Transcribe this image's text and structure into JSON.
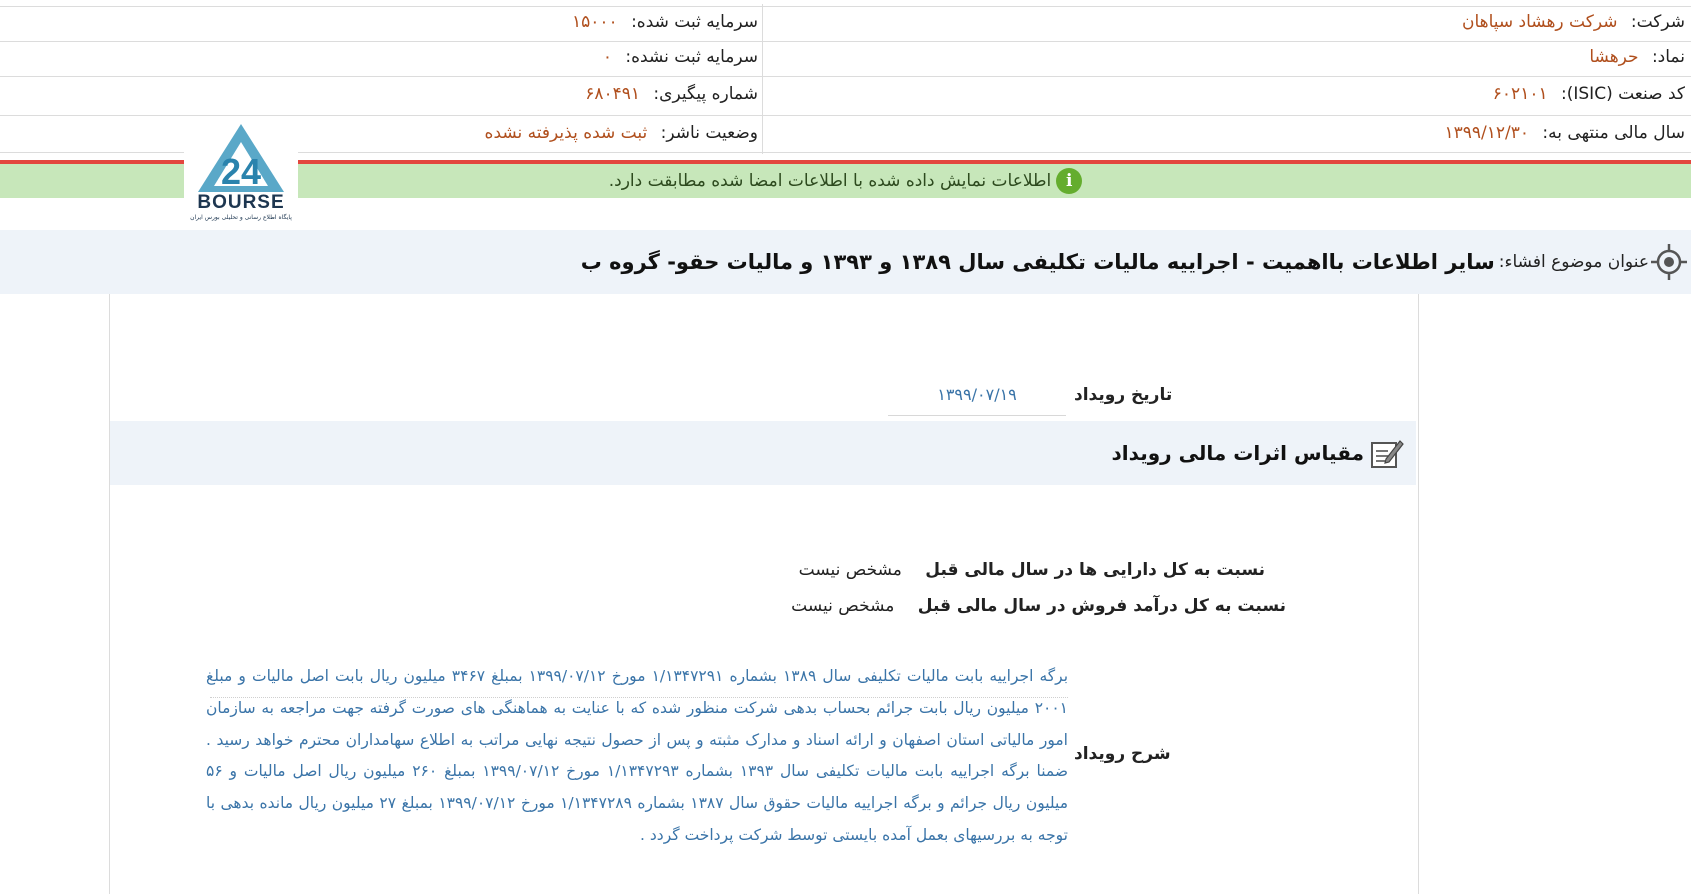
{
  "header": {
    "company_label": "شرکت:",
    "company_value": "شرکت رهشاد سپاهان",
    "symbol_label": "نماد:",
    "symbol_value": "حرهشا",
    "isic_label": "کد صنعت (ISIC):",
    "isic_value": "۶۰۲۱۰۱",
    "fiscal_label": "سال مالی منتهی به:",
    "fiscal_value": "۱۳۹۹/۱۲/۳۰",
    "registered_capital_label": "سرمایه ثبت شده:",
    "registered_capital_value": "۱۵۰۰۰",
    "unregistered_capital_label": "سرمایه ثبت نشده:",
    "unregistered_capital_value": "۰",
    "tracking_label": "شماره پیگیری:",
    "tracking_value": "۶۸۰۴۹۱",
    "publisher_status_label": "وضعیت ناشر:",
    "publisher_status_value": "ثبت شده پذیرفته نشده"
  },
  "colors": {
    "accent_value": "#b04f1d",
    "link_blue": "#3a74a8",
    "red_line": "#e3463e",
    "green_bar": "#c7e7ba",
    "info_green": "#64ad2e",
    "band_bg": "#eef3f9"
  },
  "notice": {
    "icon": "info-icon",
    "text": "اطلاعات نمایش داده شده با اطلاعات امضا شده مطابقت دارد."
  },
  "logo": {
    "word": "BOURSE",
    "subtitle": "پایگاه اطلاع رسانی و تحلیلی بورس ایران"
  },
  "subject": {
    "icon": "target-icon",
    "label": "عنوان موضوع افشاء:",
    "title": "سایر اطلاعات بااهمیت - اجراییه مالیات تکلیفی سال ۱۳۸۹ و ۱۳۹۳ و مالیات حقو- گروه ب"
  },
  "event": {
    "date_label": "تاریخ رویداد",
    "date_value": "۱۳۹۹/۰۷/۱۹"
  },
  "financial_impact": {
    "icon": "edit-icon",
    "title": "مقیاس اثرات مالی رویداد",
    "assets_label": "نسبت به کل دارایی ها در سال مالی قبل",
    "assets_value": "مشخص نیست",
    "revenue_label": "نسبت به کل درآمد فروش در سال مالی قبل",
    "revenue_value": "مشخص نیست"
  },
  "description": {
    "label": "شرح رویداد",
    "text": "برگه اجراییه بابت مالیات تکلیفی سال ۱۳۸۹ بشماره ۱/۱۳۴۷۲۹۱ مورخ ۱۳۹۹/۰۷/۱۲ بمبلغ ۳۴۶۷ میلیون ریال بابت اصل مالیات و مبلغ ۲۰۰۱ میلیون ریال بابت جرائم بحساب بدهی شرکت منظور شده که با عنایت به هماهنگی های صورت گرفته جهت مراجعه به سازمان امور مالیاتی استان اصفهان و ارائه اسناد و مدارک مثبته و پس از حصول نتیجه نهایی مراتب به اطلاع سهامداران محترم خواهد رسید . ضمنا برگه اجراییه بابت مالیات تکلیفی سال ۱۳۹۳ بشماره ۱/۱۳۴۷۲۹۳ مورخ ۱۳۹۹/۰۷/۱۲ بمبلغ ۲۶۰ میلیون ریال اصل مالیات و ۵۶ میلیون ریال جرائم و برگه اجراییه مالیات حقوق سال ۱۳۸۷ بشماره ۱/۱۳۴۷۲۸۹ مورخ ۱۳۹۹/۰۷/۱۲ بمبلغ ۲۷ میلیون ریال مانده بدهی با توجه به بررسیهای بعمل آمده بایستی توسط شرکت پرداخت گردد ."
  }
}
